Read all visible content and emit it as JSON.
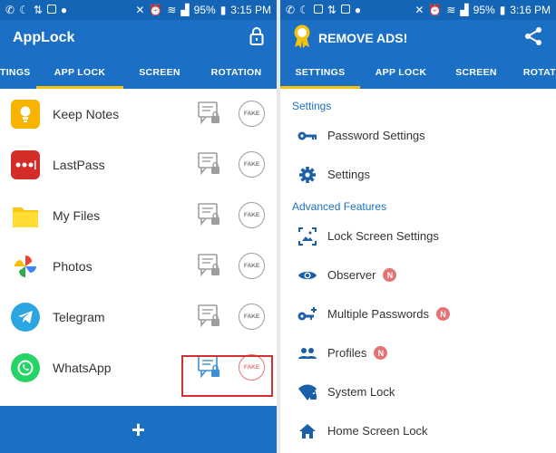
{
  "left": {
    "status": {
      "battery": "95%",
      "time": "3:15 PM"
    },
    "title": "AppLock",
    "tabs": [
      "TINGS",
      "APP LOCK",
      "SCREEN",
      "ROTATION"
    ],
    "apps": [
      {
        "name": "Keep Notes",
        "fake": "FAKE"
      },
      {
        "name": "LastPass",
        "fake": "FAKE"
      },
      {
        "name": "My Files",
        "fake": "FAKE"
      },
      {
        "name": "Photos",
        "fake": "FAKE"
      },
      {
        "name": "Telegram",
        "fake": "FAKE"
      },
      {
        "name": "WhatsApp",
        "fake": "FAKE"
      }
    ],
    "fab": "+"
  },
  "right": {
    "status": {
      "battery": "95%",
      "time": "3:16 PM"
    },
    "title": "REMOVE ADS!",
    "tabs": [
      "SETTINGS",
      "APP LOCK",
      "SCREEN",
      "ROTAT"
    ],
    "section1": "Settings",
    "items1": [
      "Password Settings",
      "Settings"
    ],
    "section2": "Advanced Features",
    "items2": [
      "Lock Screen Settings",
      "Observer",
      "Multiple Passwords",
      "Profiles",
      "System Lock",
      "Home Screen Lock"
    ],
    "badge": "N"
  },
  "colors": {
    "primary": "#1b6fc4",
    "status": "#1565b7",
    "accent": "#f4c20d",
    "highlight": "#d32f2f",
    "badge": "#e57373"
  }
}
